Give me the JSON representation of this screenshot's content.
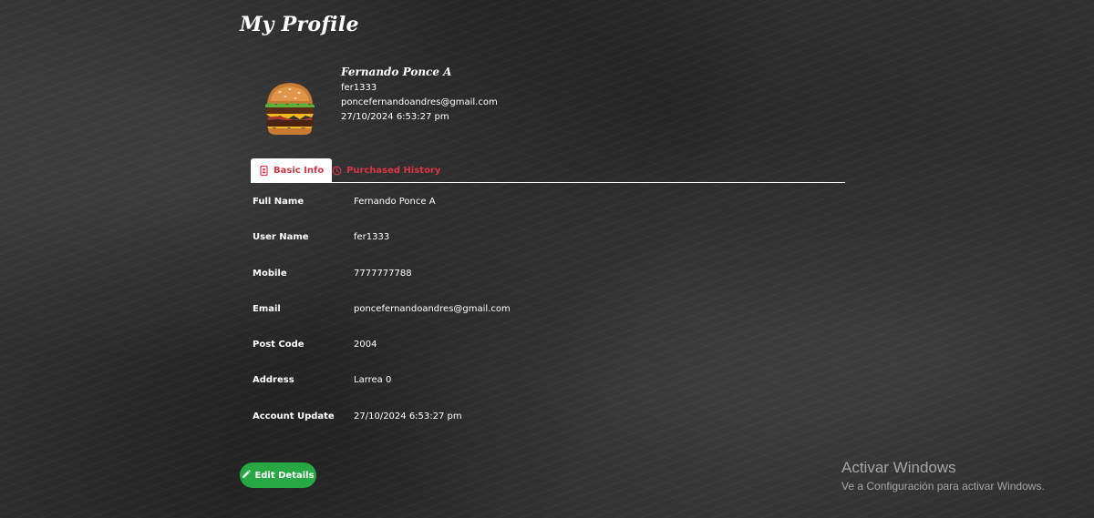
{
  "page": {
    "title": "My Profile"
  },
  "profile": {
    "name": "Fernando Ponce A",
    "username": "fer1333",
    "email": "poncefernandoandres@gmail.com",
    "updated": "27/10/2024 6:53:27 pm",
    "avatar_icon": "burger-avatar-icon"
  },
  "tabs": [
    {
      "label": "Basic Info",
      "icon": "id-badge-icon",
      "active": true
    },
    {
      "label": "Purchased History",
      "icon": "history-icon",
      "active": false
    }
  ],
  "details": [
    {
      "label": "Full Name",
      "value": "Fernando Ponce A"
    },
    {
      "label": "User Name",
      "value": "fer1333"
    },
    {
      "label": "Mobile",
      "value": "7777777788"
    },
    {
      "label": "Email",
      "value": "poncefernandoandres@gmail.com"
    },
    {
      "label": "Post Code",
      "value": "2004"
    },
    {
      "label": "Address",
      "value": "Larrea 0"
    },
    {
      "label": "Account Update",
      "value": "27/10/2024 6:53:27 pm"
    }
  ],
  "actions": {
    "edit_label": "Edit Details",
    "edit_icon": "pencil-icon"
  },
  "watermark": {
    "title": "Activar Windows",
    "subtitle": "Ve a Configuración para activar Windows."
  },
  "colors": {
    "accent_red": "#dc3545",
    "button_green": "#28a745",
    "background": "#2f2f2f"
  }
}
